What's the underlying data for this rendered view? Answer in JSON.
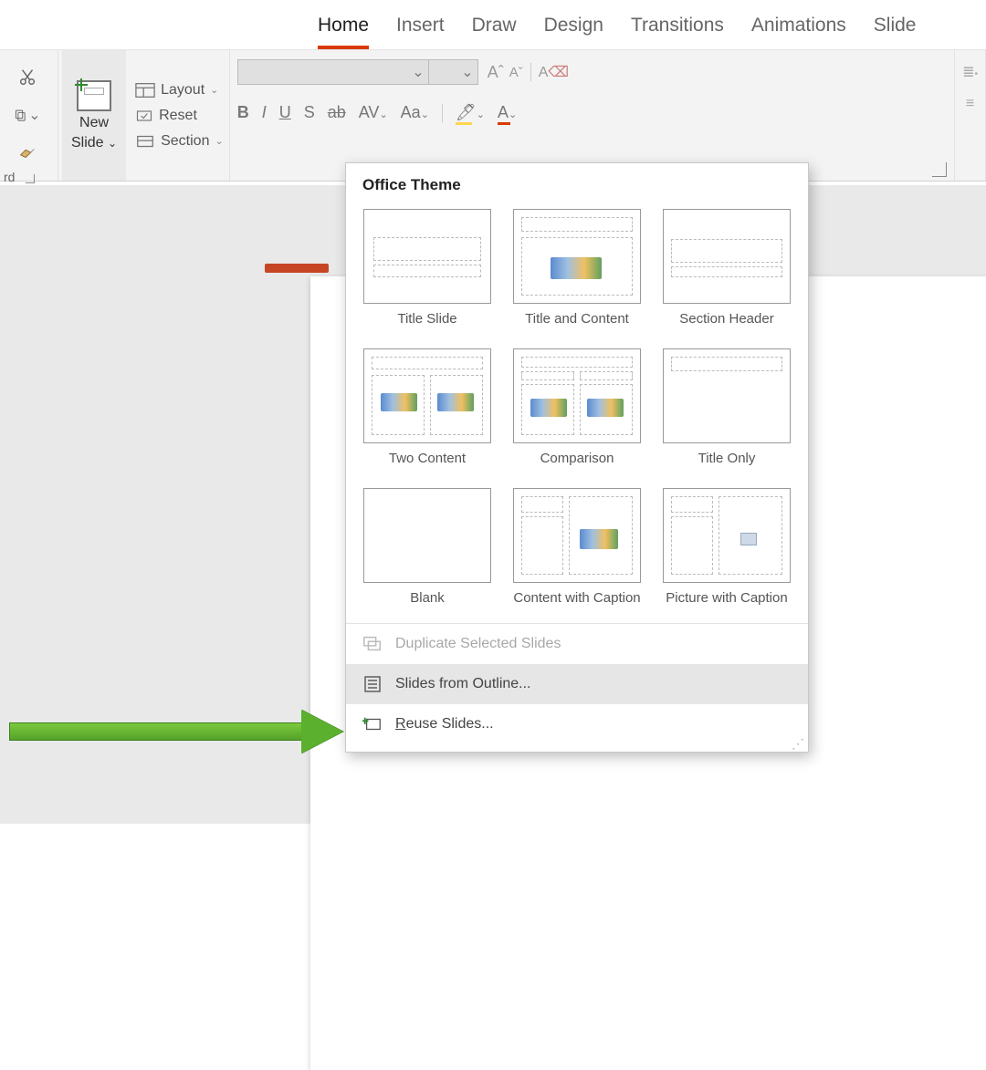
{
  "tabs": {
    "home": "Home",
    "insert": "Insert",
    "draw": "Draw",
    "design": "Design",
    "transitions": "Transitions",
    "animations": "Animations",
    "slideshow": "Slide"
  },
  "ribbon": {
    "new_slide_line1": "New",
    "new_slide_line2": "Slide",
    "layout": "Layout",
    "reset": "Reset",
    "section": "Section"
  },
  "dropdown": {
    "title": "Office Theme",
    "layouts": [
      "Title Slide",
      "Title and Content",
      "Section Header",
      "Two Content",
      "Comparison",
      "Title Only",
      "Blank",
      "Content with Caption",
      "Picture with Caption"
    ],
    "duplicate": "Duplicate Selected Slides",
    "outline": "Slides from Outline...",
    "reuse_prefix": "R",
    "reuse_rest": "euse Slides..."
  }
}
